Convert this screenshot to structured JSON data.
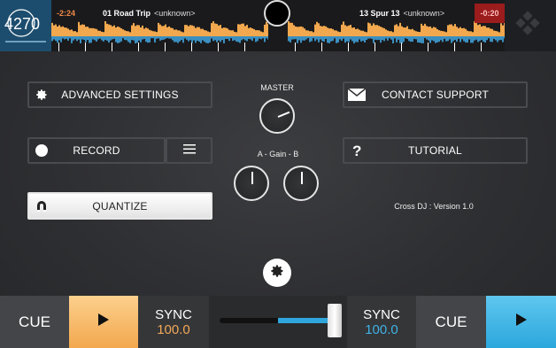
{
  "deck_a": {
    "time": "-2:24",
    "title": "01 Road Trip",
    "artist": "<unknown>"
  },
  "deck_b": {
    "time": "-0:20",
    "title": "13 Spur 13",
    "artist": "<unknown>"
  },
  "settings": {
    "advanced_label": "ADVANCED SETTINGS",
    "contact_label": "CONTACT SUPPORT",
    "record_label": "RECORD",
    "tutorial_label": "TUTORIAL",
    "quantize_label": "QUANTIZE",
    "master_label": "MASTER",
    "gain_label": "A -  Gain  - B",
    "version": "Cross DJ : Version 1.0"
  },
  "knobs": {
    "master": 0.75,
    "gain_a": 0.5,
    "gain_b": 0.5
  },
  "bottom": {
    "cue_left": "CUE",
    "sync_left_label": "SYNC",
    "sync_left_value": "100.0",
    "sync_right_label": "SYNC",
    "sync_right_value": "100.0",
    "cue_right": "CUE",
    "crossfader": 0.97
  },
  "colors": {
    "deck_a_accent": "#f2a84e",
    "deck_b_accent": "#2ba7dc",
    "deck_b_time_bg": "#9b1c1c"
  },
  "art_left_text": "4270"
}
